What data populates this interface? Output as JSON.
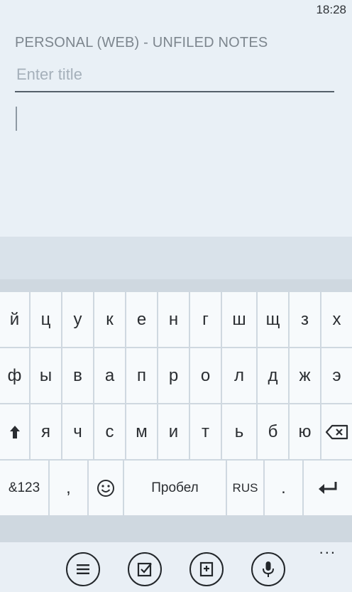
{
  "status": {
    "time": "18:28"
  },
  "note": {
    "header": "PERSONAL (WEB) - UNFILED NOTES",
    "title_placeholder": "Enter title",
    "title_value": ""
  },
  "keyboard": {
    "row1": [
      "й",
      "ц",
      "у",
      "к",
      "е",
      "н",
      "г",
      "ш",
      "щ",
      "з",
      "х"
    ],
    "row2": [
      "ф",
      "ы",
      "в",
      "а",
      "п",
      "р",
      "о",
      "л",
      "д",
      "ж",
      "э"
    ],
    "row3": [
      "я",
      "ч",
      "с",
      "м",
      "и",
      "т",
      "ь",
      "б",
      "ю"
    ],
    "row4": {
      "symbols": "&123",
      "comma": ",",
      "space": "Пробел",
      "language": "RUS",
      "period": "."
    }
  },
  "app_bar": {
    "buttons": [
      "list-icon",
      "checkbox-icon",
      "attach-icon",
      "microphone-icon"
    ],
    "more": "..."
  }
}
